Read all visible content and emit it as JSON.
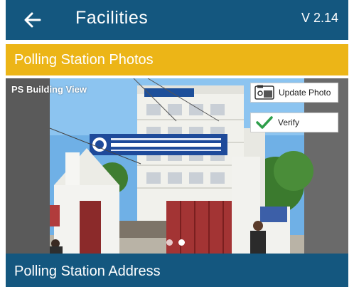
{
  "app": {
    "title": "Facilities",
    "version": "V 2.14",
    "back_icon": "arrow-left-icon"
  },
  "sections": {
    "photos_title": "Polling Station Photos",
    "address_title": "Polling Station Address"
  },
  "photo": {
    "caption": "PS Building View",
    "sign_text": "RAJKIY MAHAVIDYALAYA COLLEGE OF EDUCATION & MANAGEMENT",
    "current_slide": 2,
    "total_slides": 2
  },
  "actions": {
    "update_photo_label": "Update Photo",
    "update_photo_icon": "camera-gallery-icon",
    "verify_label": "Verify",
    "verify_icon": "check-icon"
  },
  "colors": {
    "appbar": "#14577f",
    "section_photos": "#ecb517",
    "verify_check": "#2e9e4a"
  }
}
